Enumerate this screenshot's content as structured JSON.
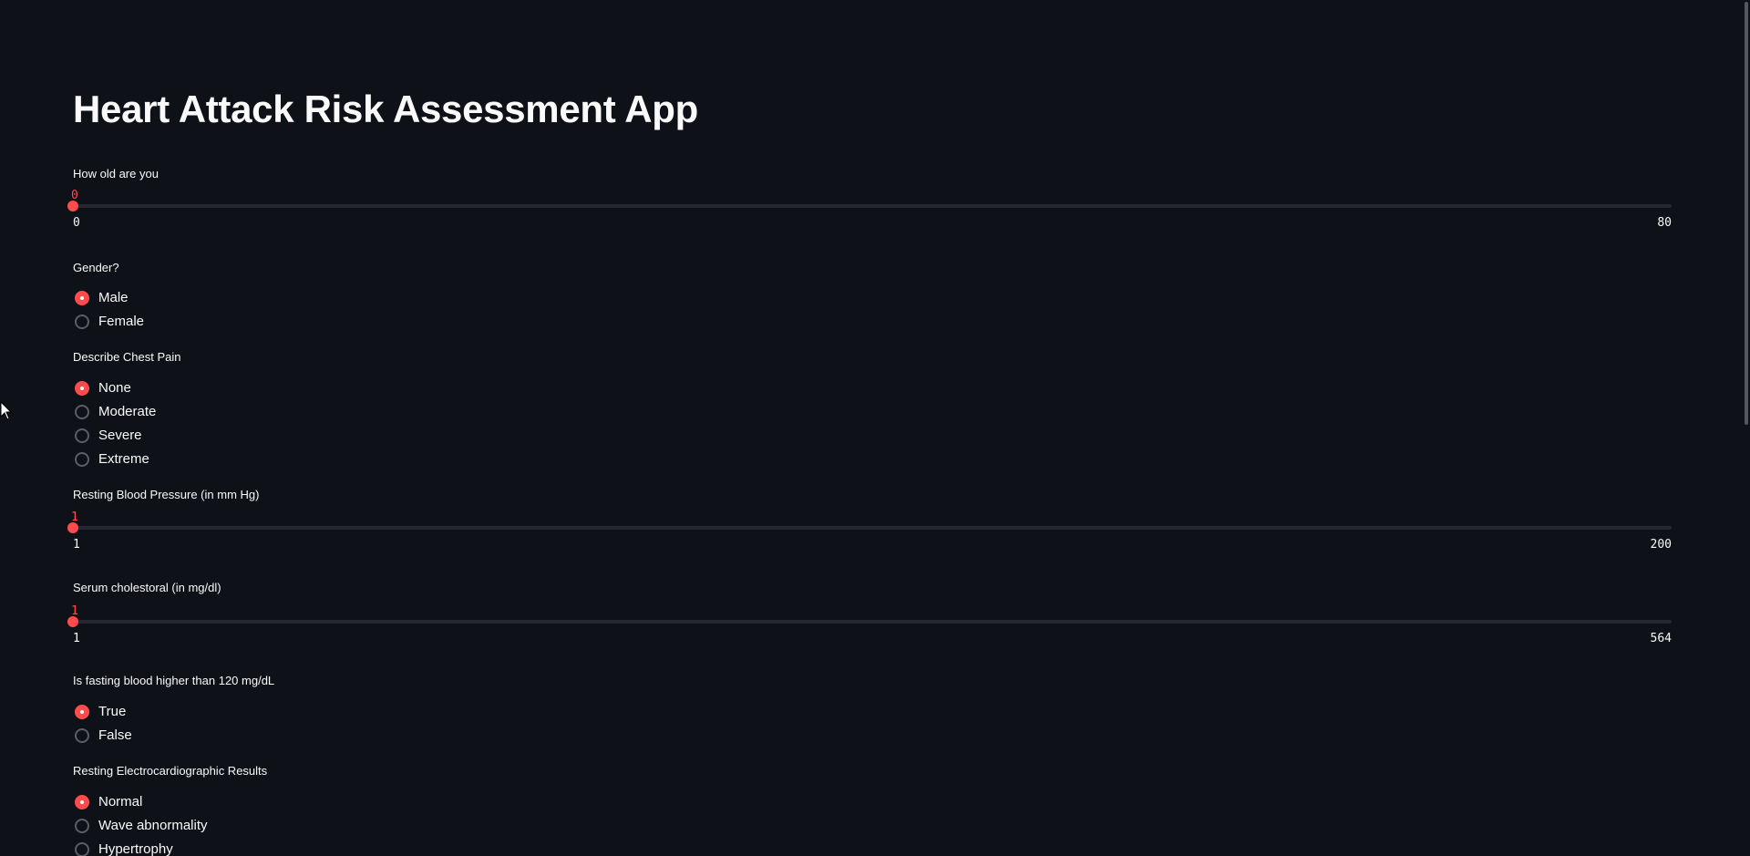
{
  "app": {
    "title": "Heart Attack Risk Assessment App"
  },
  "colors": {
    "background": "#0e1117",
    "accent": "#ff4b4b",
    "text": "#fafafa",
    "track": "#262730"
  },
  "age": {
    "label": "How old are you",
    "value": "0",
    "min": "0",
    "max": "80"
  },
  "gender": {
    "label": "Gender?",
    "options": [
      "Male",
      "Female"
    ],
    "selected": "Male"
  },
  "chest_pain": {
    "label": "Describe Chest Pain",
    "options": [
      "None",
      "Moderate",
      "Severe",
      "Extreme"
    ],
    "selected": "None"
  },
  "blood_pressure": {
    "label": "Resting Blood Pressure (in mm Hg)",
    "value": "1",
    "min": "1",
    "max": "200"
  },
  "cholesterol": {
    "label": "Serum cholestoral (in mg/dl)",
    "value": "1",
    "min": "1",
    "max": "564"
  },
  "fasting_blood": {
    "label": "Is fasting blood higher than 120 mg/dL",
    "options": [
      "True",
      "False"
    ],
    "selected": "True"
  },
  "ecg": {
    "label": "Resting Electrocardiographic Results",
    "options": [
      "Normal",
      "Wave abnormality",
      "Hypertrophy"
    ],
    "selected": "Normal"
  }
}
